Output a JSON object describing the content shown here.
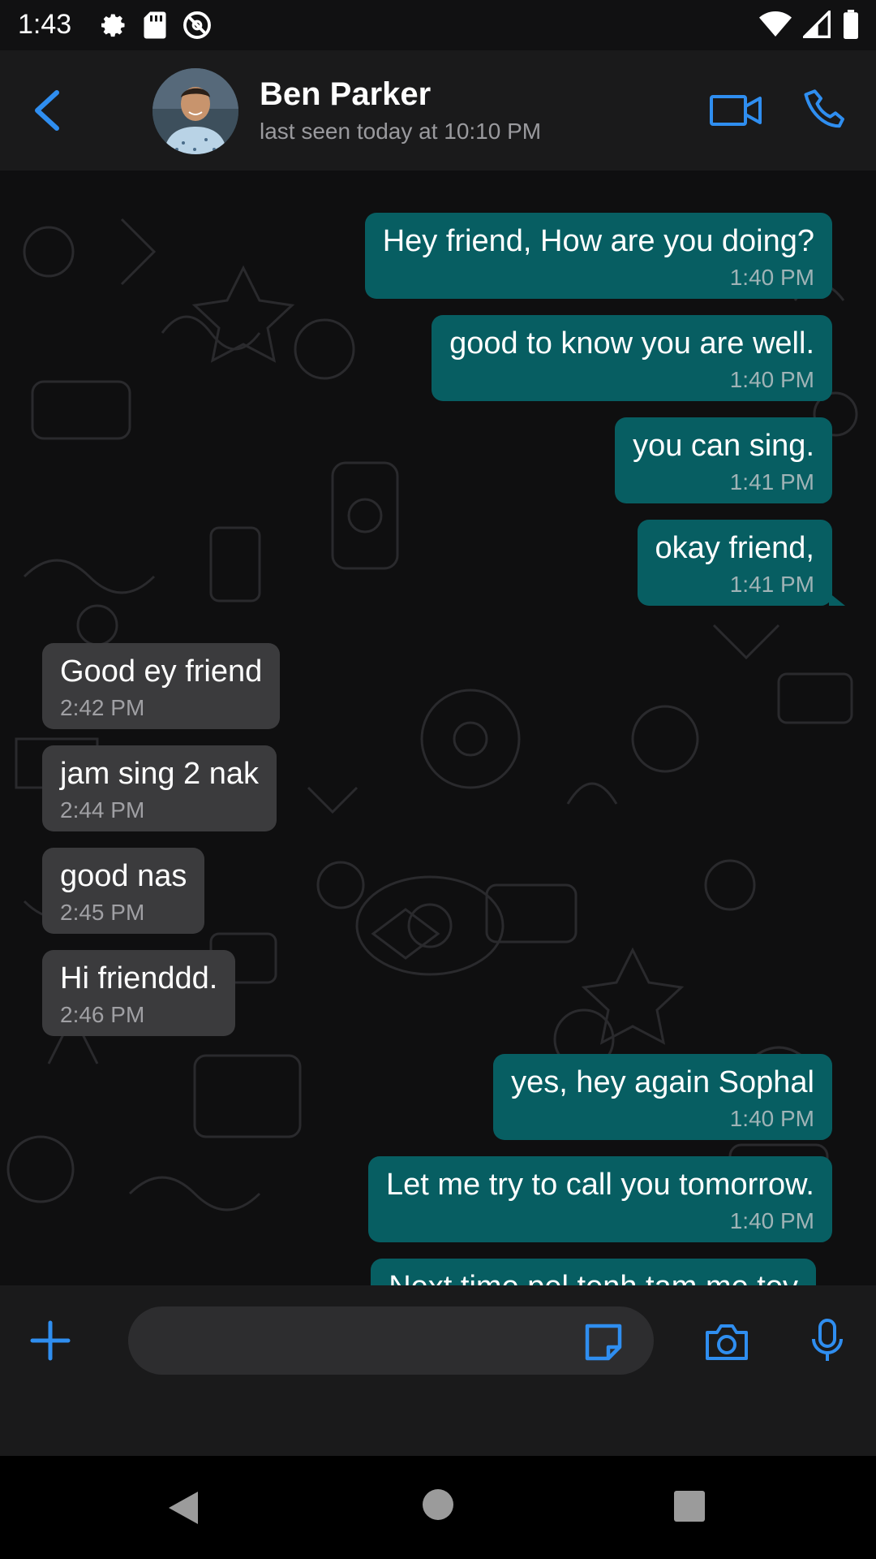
{
  "status_bar": {
    "time": "1:43",
    "left_icons": [
      "settings-gear-icon",
      "sd-card-icon",
      "no-disturb-icon"
    ],
    "right_icons": [
      "wifi-icon",
      "signal-icon",
      "battery-icon"
    ]
  },
  "header": {
    "contact_name": "Ben Parker",
    "contact_status": "last seen today at 10:10 PM",
    "accent_color": "#2f8ef0"
  },
  "messages": [
    {
      "direction": "out",
      "text": "Hey friend, How are you doing?",
      "time": "1:40 PM"
    },
    {
      "direction": "out",
      "text": "good to know you are well.",
      "time": "1:40 PM"
    },
    {
      "direction": "out",
      "text": "you can sing.",
      "time": "1:41 PM"
    },
    {
      "direction": "out",
      "text": "okay friend,",
      "time": "1:41 PM"
    },
    {
      "direction": "in",
      "text": "Good ey friend",
      "time": "2:42 PM"
    },
    {
      "direction": "in",
      "text": "jam sing 2 nak",
      "time": "2:44 PM"
    },
    {
      "direction": "in",
      "text": "good nas",
      "time": "2:45 PM"
    },
    {
      "direction": "in",
      "text": "Hi frienddd.",
      "time": "2:46 PM"
    },
    {
      "direction": "out",
      "text": "yes, hey again Sophal",
      "time": "1:40 PM"
    },
    {
      "direction": "out",
      "text": "Let me try to call you tomorrow.",
      "time": "1:40 PM"
    },
    {
      "direction": "out",
      "text": "Next time pel tenh tam me tov",
      "time": ""
    }
  ],
  "composer": {
    "value": "",
    "placeholder": ""
  },
  "colors": {
    "outgoing_bubble": "#075e62",
    "incoming_bubble": "#3b3b3d",
    "background": "#0f0f10"
  }
}
